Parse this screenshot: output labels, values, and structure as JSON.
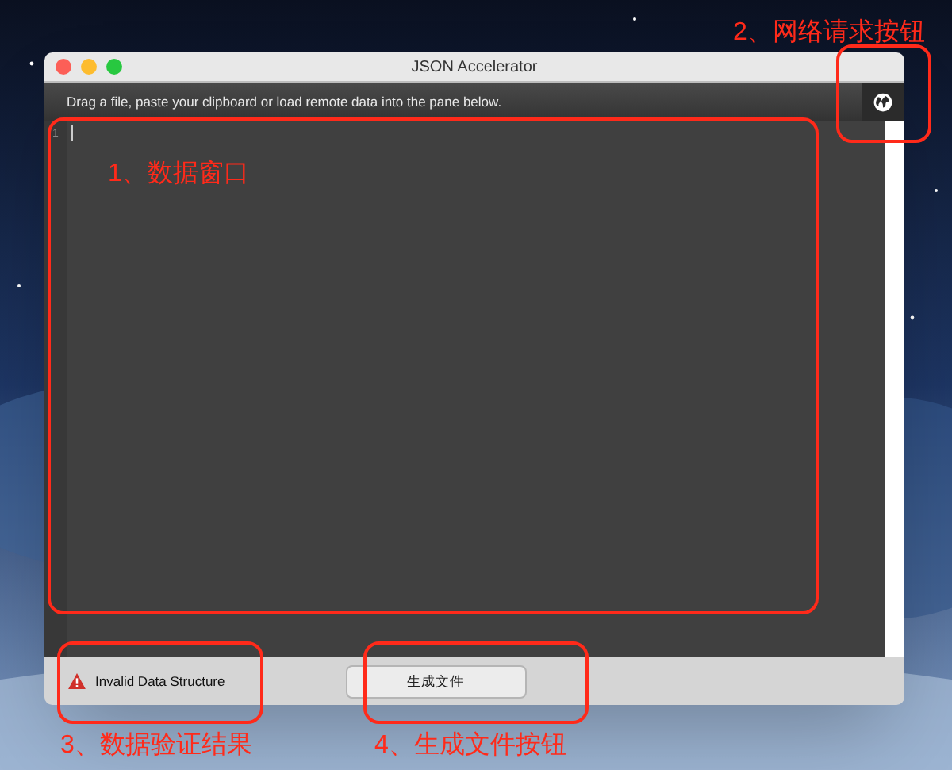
{
  "window": {
    "title": "JSON Accelerator"
  },
  "toolbar": {
    "hint": "Drag a file, paste your clipboard or load remote data into the pane below."
  },
  "editor": {
    "line_numbers": [
      "1"
    ]
  },
  "status": {
    "message": "Invalid Data Structure"
  },
  "generate_button": {
    "label": "生成文件"
  },
  "annotations": [
    {
      "label": "1、数据窗口"
    },
    {
      "label": "2、网络请求按钮"
    },
    {
      "label": "3、数据验证结果"
    },
    {
      "label": "4、生成文件按钮"
    }
  ]
}
